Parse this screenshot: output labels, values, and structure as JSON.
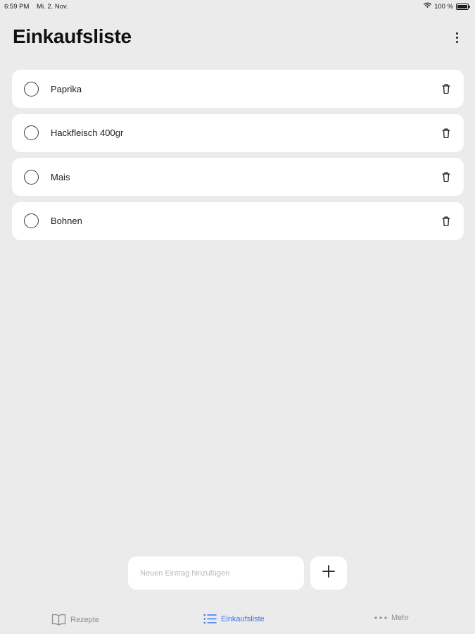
{
  "status_bar": {
    "time": "6:59 PM",
    "date": "Mi. 2. Nov.",
    "battery": "100 %",
    "battery_level": 1.0
  },
  "header": {
    "title": "Einkaufsliste",
    "menu_icon": "ellipsis-vertical-icon"
  },
  "items": [
    {
      "label": "Paprika",
      "checked": false
    },
    {
      "label": "Hackfleisch 400gr",
      "checked": false
    },
    {
      "label": "Mais",
      "checked": false
    },
    {
      "label": "Bohnen",
      "checked": false
    }
  ],
  "add_entry": {
    "placeholder": "Neuen Eintrag hinzufügen",
    "value": "",
    "button_icon": "plus-icon"
  },
  "tab_bar": {
    "tabs": [
      {
        "label": "Rezepte",
        "icon": "book-icon",
        "active": false
      },
      {
        "label": "Einkaufsliste",
        "icon": "list-icon",
        "active": true
      },
      {
        "label": "Mehr",
        "icon": "ellipsis-horizontal-icon",
        "active": false
      }
    ]
  },
  "colors": {
    "background": "#ebebeb",
    "card": "#ffffff",
    "accent": "#3478f6",
    "inactive": "#8e8e93"
  }
}
